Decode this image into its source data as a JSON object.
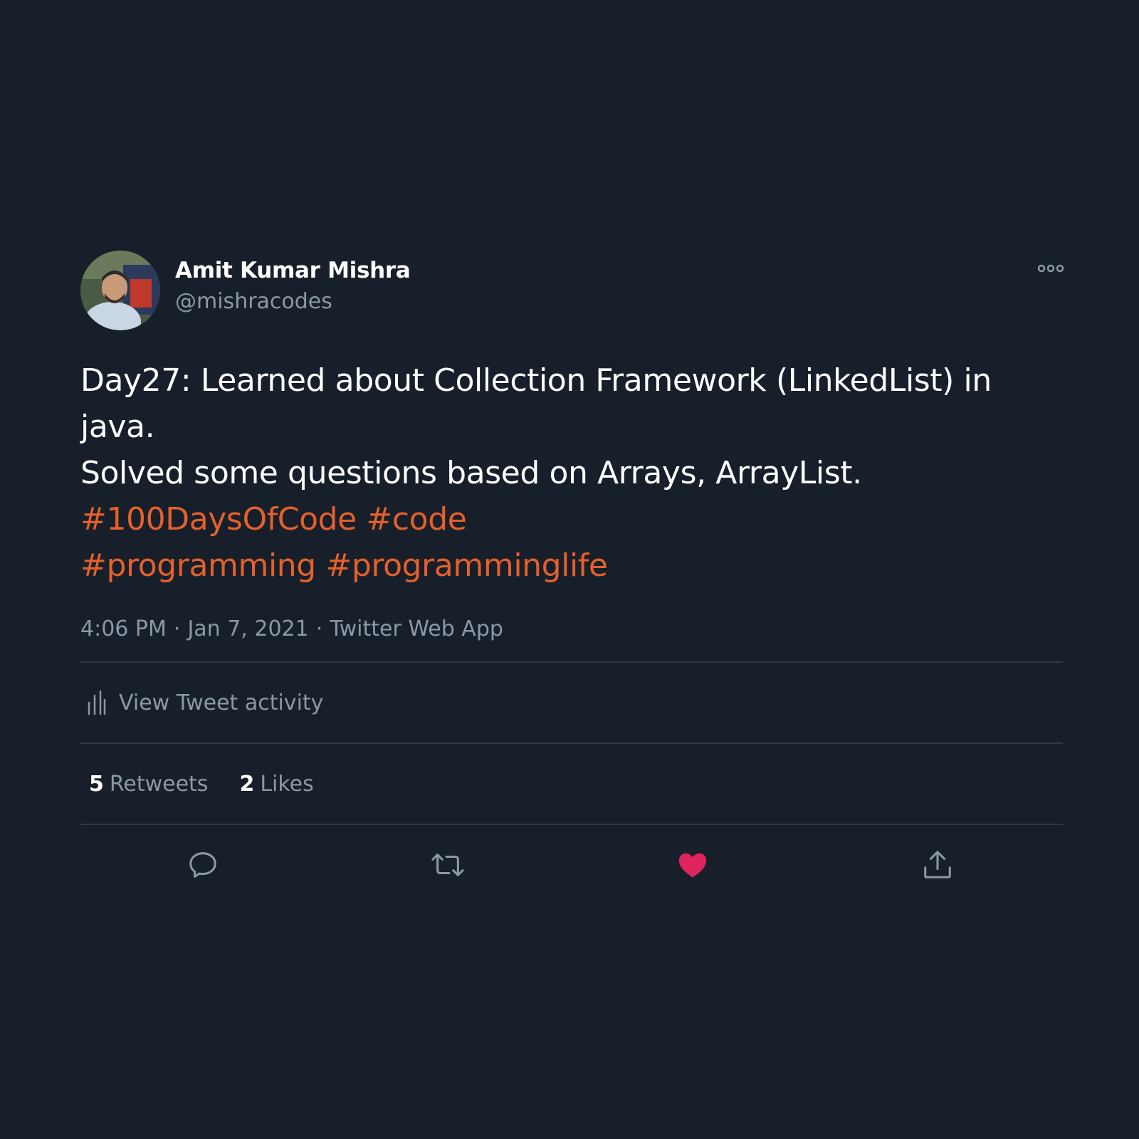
{
  "author": {
    "name": "Amit Kumar Mishra",
    "handle": "@mishracodes"
  },
  "tweet": {
    "text_line1": "Day27: Learned about Collection Framework (LinkedList) in",
    "text_line2": "java.",
    "text_line3": "Solved some questions based on Arrays, ArrayList.",
    "hashtags_line1": [
      "#100DaysOfCode",
      "#code"
    ],
    "hashtags_line2": [
      "#programming",
      "#programminglife"
    ],
    "time": "4:06 PM",
    "date": "Jan 7, 2021",
    "source": "Twitter Web App",
    "separator": "·"
  },
  "activity": {
    "label": "View Tweet activity",
    "icon": "bar-chart-icon"
  },
  "stats": {
    "retweets_count": "5",
    "retweets_label": "Retweets",
    "likes_count": "2",
    "likes_label": "Likes"
  },
  "actions": {
    "reply_icon": "reply-icon",
    "retweet_icon": "retweet-icon",
    "like_icon": "heart-icon",
    "share_icon": "share-icon"
  },
  "colors": {
    "background": "#171f2a",
    "hashtag": "#e5602a",
    "secondary_text": "#8b98a5",
    "like": "#e0245e",
    "divider": "#2f3a46"
  }
}
